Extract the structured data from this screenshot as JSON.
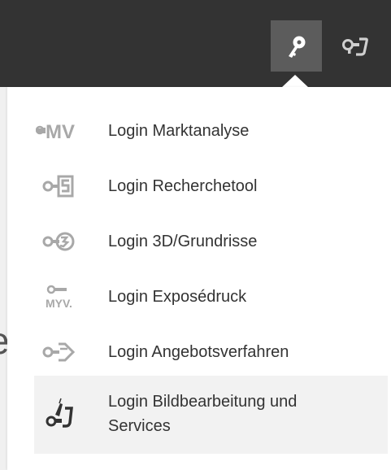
{
  "topbar": {
    "key_icon": "key-icon",
    "logout_icon": "logout-icon"
  },
  "background": {
    "partial_text": "e"
  },
  "menu": {
    "items": [
      {
        "label": "Login Marktanalyse",
        "icon": "marktanalyse-icon",
        "icon_text": "MV"
      },
      {
        "label": "Login Recherchetool",
        "icon": "recherchetool-icon"
      },
      {
        "label": "Login 3D/Grundrisse",
        "icon": "grundrisse-icon"
      },
      {
        "label": "Login Exposédruck",
        "icon": "exposedruck-icon",
        "icon_text": "MYV."
      },
      {
        "label": "Login Angebotsverfahren",
        "icon": "angebotsverfahren-icon"
      },
      {
        "label": "Login Bildbearbeitung und Services",
        "label_line1": "Login Bildbearbeitung und",
        "label_line2": "Services",
        "icon": "bildbearbeitung-icon",
        "active": true
      }
    ]
  },
  "colors": {
    "topbar": "#333333",
    "key_button": "#5c5c5c",
    "icon_gray": "#9a9a9a",
    "text": "#333333",
    "active_bg": "#f2f2f2"
  }
}
